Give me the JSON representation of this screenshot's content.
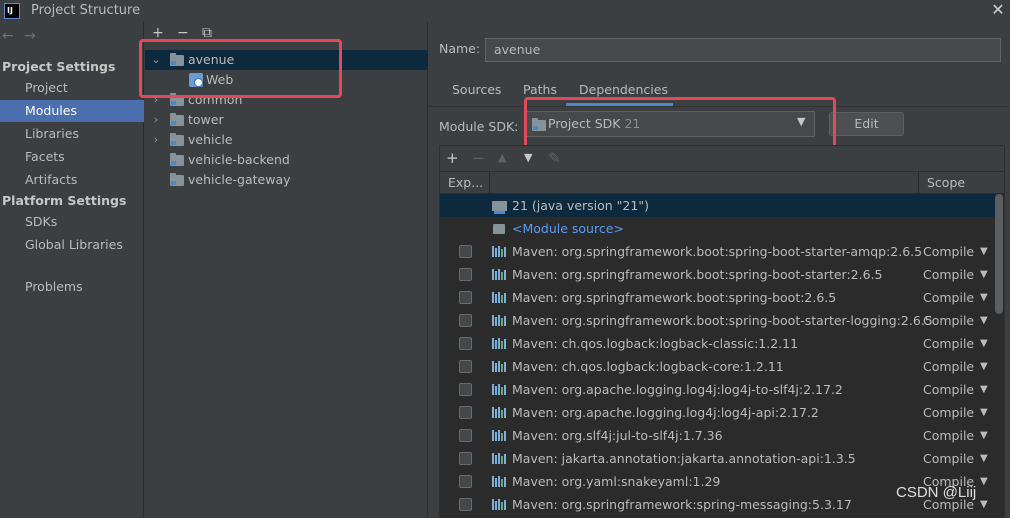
{
  "window": {
    "title": "Project Structure",
    "app_icon_text": "IJ"
  },
  "nav": {
    "back_glyph": "←",
    "forward_glyph": "→",
    "project_settings_header": "Project Settings",
    "project_settings": [
      "Project",
      "Modules",
      "Libraries",
      "Facets",
      "Artifacts"
    ],
    "platform_settings_header": "Platform Settings",
    "platform_settings": [
      "SDKs",
      "Global Libraries"
    ],
    "problems": "Problems",
    "selected": "Modules"
  },
  "tree": {
    "toolbar": [
      "+",
      "−",
      "⧉"
    ],
    "items": [
      {
        "label": "avenue",
        "expanded": true,
        "selected": true
      },
      {
        "label": "Web",
        "child": true
      },
      {
        "label": "common"
      },
      {
        "label": "tower"
      },
      {
        "label": "vehicle"
      },
      {
        "label": "vehicle-backend"
      },
      {
        "label": "vehicle-gateway"
      }
    ]
  },
  "detail": {
    "name_label": "Name:",
    "name_value": "avenue",
    "tabs": [
      "Sources",
      "Paths",
      "Dependencies"
    ],
    "active_tab": "Dependencies",
    "module_sdk_label": "Module SDK:",
    "module_sdk_value": "Project SDK",
    "module_sdk_version": "21",
    "edit_button": "Edit"
  },
  "dependencies": {
    "toolbar": [
      "+",
      "−",
      "▲",
      "▼",
      "✎"
    ],
    "columns": [
      "Exp...",
      "Scope"
    ],
    "sdk_row": "21 (java version \"21\")",
    "module_source_row": "<Module source>",
    "rows": [
      {
        "name": "Maven: org.springframework.boot:spring-boot-starter-amqp:2.6.5",
        "scope": "Compile"
      },
      {
        "name": "Maven: org.springframework.boot:spring-boot-starter:2.6.5",
        "scope": "Compile"
      },
      {
        "name": "Maven: org.springframework.boot:spring-boot:2.6.5",
        "scope": "Compile"
      },
      {
        "name": "Maven: org.springframework.boot:spring-boot-starter-logging:2.6.5",
        "scope": "Compile"
      },
      {
        "name": "Maven: ch.qos.logback:logback-classic:1.2.11",
        "scope": "Compile"
      },
      {
        "name": "Maven: ch.qos.logback:logback-core:1.2.11",
        "scope": "Compile"
      },
      {
        "name": "Maven: org.apache.logging.log4j:log4j-to-slf4j:2.17.2",
        "scope": "Compile"
      },
      {
        "name": "Maven: org.apache.logging.log4j:log4j-api:2.17.2",
        "scope": "Compile"
      },
      {
        "name": "Maven: org.slf4j:jul-to-slf4j:1.7.36",
        "scope": "Compile"
      },
      {
        "name": "Maven: jakarta.annotation:jakarta.annotation-api:1.3.5",
        "scope": "Compile"
      },
      {
        "name": "Maven: org.yaml:snakeyaml:1.29",
        "scope": "Compile"
      },
      {
        "name": "Maven: org.springframework:spring-messaging:5.3.17",
        "scope": "Compile"
      }
    ]
  },
  "watermark": "CSDN @Liij",
  "colors": {
    "selection": "#4b6eaf",
    "tree_selection": "#0d293e",
    "highlight_box": "#e24a5c",
    "accent": "#4a88c7"
  }
}
